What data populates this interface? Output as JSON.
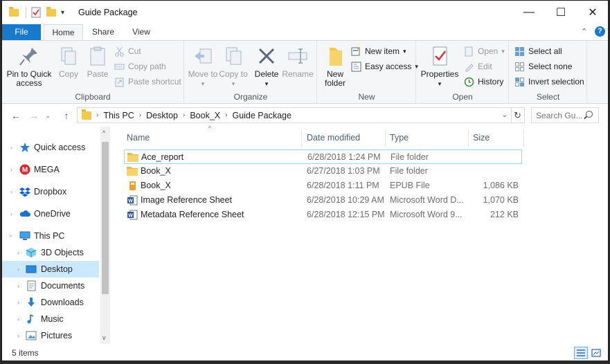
{
  "window": {
    "title": "Guide Package",
    "controls": {
      "minimize": "—",
      "maximize": "☐",
      "close": "✕"
    }
  },
  "ribbon_tabs": [
    {
      "label": "File"
    },
    {
      "label": "Home"
    },
    {
      "label": "Share"
    },
    {
      "label": "View"
    }
  ],
  "ribbon": {
    "clipboard": {
      "label": "Clipboard",
      "pin": "Pin to Quick access",
      "copy": "Copy",
      "paste": "Paste",
      "cut": "Cut",
      "copy_path": "Copy path",
      "paste_shortcut": "Paste shortcut"
    },
    "organize": {
      "label": "Organize",
      "move_to": "Move to",
      "copy_to": "Copy to",
      "delete": "Delete",
      "rename": "Rename"
    },
    "new": {
      "label": "New",
      "new_folder": "New folder",
      "new_item": "New item",
      "easy_access": "Easy access"
    },
    "open": {
      "label": "Open",
      "properties": "Properties",
      "open": "Open",
      "edit": "Edit",
      "history": "History"
    },
    "select": {
      "label": "Select",
      "select_all": "Select all",
      "select_none": "Select none",
      "invert": "Invert selection"
    }
  },
  "address": {
    "crumbs": [
      "This PC",
      "Desktop",
      "Book_X",
      "Guide Package"
    ],
    "search_placeholder": "Search Gu..."
  },
  "nav": [
    {
      "label": "Quick access",
      "icon": "star-icon"
    },
    {
      "label": "MEGA",
      "icon": "mega-icon"
    },
    {
      "label": "Dropbox",
      "icon": "dropbox-icon"
    },
    {
      "label": "OneDrive",
      "icon": "cloud-icon"
    },
    {
      "label": "This PC",
      "icon": "computer-icon"
    },
    {
      "label": "3D Objects",
      "icon": "cube-icon"
    },
    {
      "label": "Desktop",
      "icon": "desktop-icon"
    },
    {
      "label": "Documents",
      "icon": "documents-icon"
    },
    {
      "label": "Downloads",
      "icon": "download-icon"
    },
    {
      "label": "Music",
      "icon": "music-icon"
    },
    {
      "label": "Pictures",
      "icon": "pictures-icon"
    }
  ],
  "columns": {
    "name": "Name",
    "date": "Date modified",
    "type": "Type",
    "size": "Size"
  },
  "files": [
    {
      "name": "Ace_report",
      "date": "6/28/2018 1:24 PM",
      "type": "File folder",
      "size": "",
      "icon": "folder-icon"
    },
    {
      "name": "Book_X",
      "date": "6/27/2018 1:03 PM",
      "type": "File folder",
      "size": "",
      "icon": "folder-icon"
    },
    {
      "name": "Book_X",
      "date": "6/28/2018 1:11 PM",
      "type": "EPUB File",
      "size": "1,086 KB",
      "icon": "epub-icon"
    },
    {
      "name": "Image Reference Sheet",
      "date": "6/28/2018 10:29 AM",
      "type": "Microsoft Word D...",
      "size": "1,070 KB",
      "icon": "word-icon"
    },
    {
      "name": "Metadata Reference Sheet",
      "date": "6/28/2018 12:15 PM",
      "type": "Microsoft Word 9...",
      "size": "212 KB",
      "icon": "word-icon"
    }
  ],
  "status": {
    "items": "5 items"
  },
  "colors": {
    "accent": "#1979ca",
    "selection": "#cce8ff",
    "folder": "#f2c94c"
  }
}
